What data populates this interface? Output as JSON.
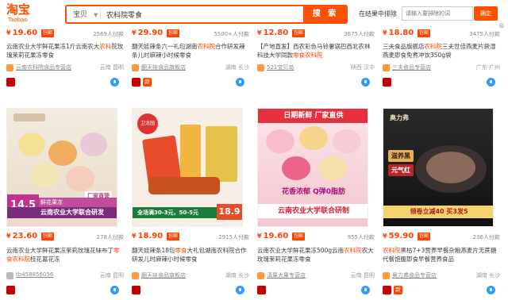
{
  "header": {
    "logo_cn": "淘宝",
    "logo_en": "Taobao",
    "search_type": "宝贝",
    "search_query": "农科院零食",
    "search_button": "搜 索",
    "in_results_label": "在结果中排除",
    "in_results_placeholder": "请输入要排除的词",
    "confirm_button": "确定"
  },
  "colors": {
    "accent": "#ff5000",
    "price": "#ff4400"
  },
  "top_row": [
    {
      "price": "19.60",
      "paid": "2569人付款",
      "title_pre": "云南农业大学鲜花果冻1斤云南农大",
      "title_hl": "农科",
      "title_post": "院玫瑰茉莉花果冻零食",
      "shop": "云南农科院食品专营店",
      "loc": "云南 昆明",
      "badges": [
        "tmall"
      ]
    },
    {
      "price": "29.90",
      "paid": "5500+人付款",
      "title_pre": "翻天娃辣条六一礼包湖南",
      "title_hl": "农科院",
      "title_post": "合作研发辣条儿时麻辣小时候零食",
      "shop": "翻天娃食品旗舰店",
      "loc": "湖南 长沙",
      "badges": [
        "tmall",
        "new"
      ]
    },
    {
      "price": "12.80",
      "paid": "3675人付款",
      "title_pre": "【产地直发】西农彩色马铃薯锅巴西北农林科技大学同款",
      "title_hl": "零食农科院",
      "title_post": "",
      "shop": "521宝贝岛",
      "loc": "陕西 汉中",
      "badges": []
    },
    {
      "price": "18.80",
      "paid": "3475人付款",
      "title_pre": "三夫食品旗舰店",
      "title_hl": "农科院",
      "title_post": "三夫世佳燕麦片袋湿燕麦即食免煮冲饮350g袋",
      "shop": "三夫食品专营店",
      "loc": "广东 广州",
      "badges": [
        "tmall"
      ]
    }
  ],
  "images": [
    {
      "banner_left": "鲜花果冻",
      "banner_right": "厂家直营",
      "price_tag": "14.5",
      "strip": "云南农业大学联合研发"
    },
    {
      "brand": "卫龙园",
      "strip_left": "全场满30-3元，50-5元",
      "price_tag": "18.9"
    },
    {
      "banner": "日期新鲜 厂家直供",
      "mid": "花香浓郁 Q弹0脂肪",
      "strip": "云南农业大学联合研制"
    },
    {
      "brand": "奥力弗",
      "badge": "滋养黑",
      "sub": "元气红",
      "strip": "领卷立减40 买3发5"
    }
  ],
  "bottom_row": [
    {
      "price": "23.60",
      "paid": "278人付款",
      "title_pre": "云南农业大学鲜花果冻茉莉玫瑰花味布丁",
      "title_hl": "零食农科院",
      "title_post": "桂花葛花冻",
      "shop": "tb458856056",
      "loc": "云南 昆明",
      "badges": [
        "tmall"
      ]
    },
    {
      "price": "18.90",
      "paid": "2915人付款",
      "title_pre": "翻天娃辣条18包",
      "title_hl": "零食",
      "title_post": "大礼包湖南农科院合作研发儿时麻辣小时候零食",
      "shop": "翻天娃食品旗舰店",
      "loc": "湖南 长沙",
      "badges": [
        "tmall"
      ]
    },
    {
      "price": "19.60",
      "paid": "955人付款",
      "title_pre": "云南农业大学鲜花果冻500g云南",
      "title_hl": "农科院",
      "title_post": "农大玫瑰茉莉花果冻零食",
      "shop": "滇果大果专营店",
      "loc": "云南 昆明",
      "badges": [
        "tmall"
      ]
    },
    {
      "price": "59.90",
      "paid": "236人付款",
      "title_pre": "",
      "title_hl": "农科院",
      "title_post": "黑枯7+3营养早餐杂粮燕麦片无蔗糖代餐饱腹即食早餐营养食品",
      "shop": "奥力弗食品专营店",
      "loc": "湖南 长沙",
      "badges": [
        "tmall",
        "new"
      ]
    }
  ],
  "labels": {
    "baoyou": "包邮",
    "new": "新"
  }
}
